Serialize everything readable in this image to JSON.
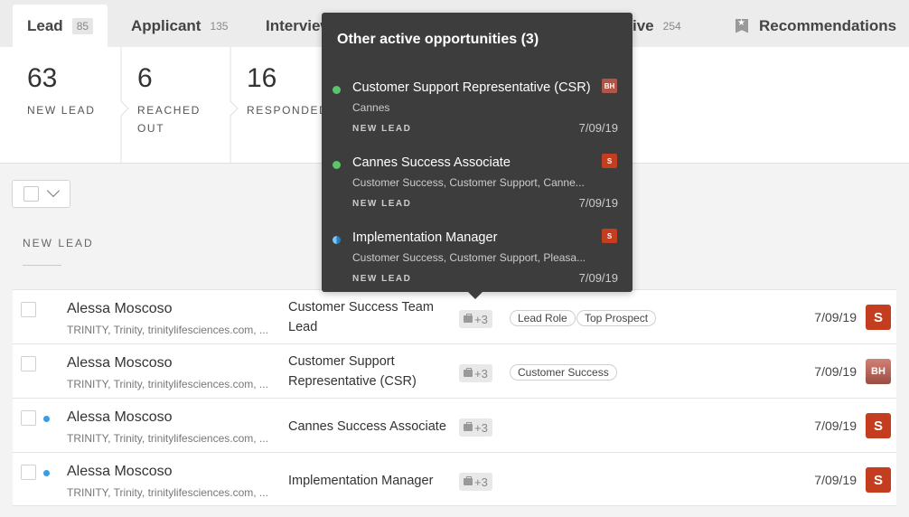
{
  "tabs": [
    {
      "label": "Lead",
      "count": "85"
    },
    {
      "label": "Applicant",
      "count": "135"
    },
    {
      "label": "Interview",
      "count": ""
    },
    {
      "label": "ive",
      "count": "254"
    },
    {
      "label": "Recommendations",
      "count": ""
    }
  ],
  "stats": [
    {
      "number": "63",
      "label": "NEW LEAD"
    },
    {
      "number": "6",
      "label": "REACHED OUT"
    },
    {
      "number": "16",
      "label": "RESPONDED"
    }
  ],
  "section_title": "NEW LEAD",
  "rows": [
    {
      "name": "Alessa Moscoso",
      "sub": "TRINITY, Trinity, trinitylifesciences.com, ...",
      "role": "Customer Success Team Lead",
      "opp": "+3",
      "tags": [
        "Lead Role",
        "Top Prospect"
      ],
      "date": "7/09/19",
      "avatar": "S"
    },
    {
      "name": "Alessa Moscoso",
      "sub": "TRINITY, Trinity, trinitylifesciences.com, ...",
      "role": "Customer Support Representative (CSR)",
      "opp": "+3",
      "tags": [
        "Customer Success"
      ],
      "date": "7/09/19",
      "avatar": "BH"
    },
    {
      "name": "Alessa Moscoso",
      "sub": "TRINITY, Trinity, trinitylifesciences.com, ...",
      "role": "Cannes Success Associate",
      "opp": "+3",
      "tags": [],
      "date": "7/09/19",
      "avatar": "S"
    },
    {
      "name": "Alessa Moscoso",
      "sub": "TRINITY, Trinity, trinitylifesciences.com, ...",
      "role": "Implementation Manager",
      "opp": "+3",
      "tags": [],
      "date": "7/09/19",
      "avatar": "S"
    }
  ],
  "popover": {
    "title": "Other active opportunities (3)",
    "items": [
      {
        "name": "Customer Support Representative (CSR)",
        "sub": "Cannes",
        "status": "NEW LEAD",
        "date": "7/09/19",
        "badge": "BH",
        "dot": "green"
      },
      {
        "name": "Cannes Success Associate",
        "sub": "Customer Success, Customer Support, Canne...",
        "status": "NEW LEAD",
        "date": "7/09/19",
        "badge": "S",
        "dot": "green"
      },
      {
        "name": "Implementation Manager",
        "sub": "Customer Success, Customer Support, Pleasa...",
        "status": "NEW LEAD",
        "date": "7/09/19",
        "badge": "S",
        "dot": "half"
      }
    ]
  },
  "colors": {
    "accent_red": "#c43d1e",
    "dot_blue": "#3a9ddf",
    "dot_green": "#5cc46a",
    "popover_bg": "#3d3d3d"
  },
  "icons": {
    "recommendations": "bookmark-star-icon",
    "opportunity": "briefcase-icon",
    "select_toggle": "chevron-down-icon"
  }
}
